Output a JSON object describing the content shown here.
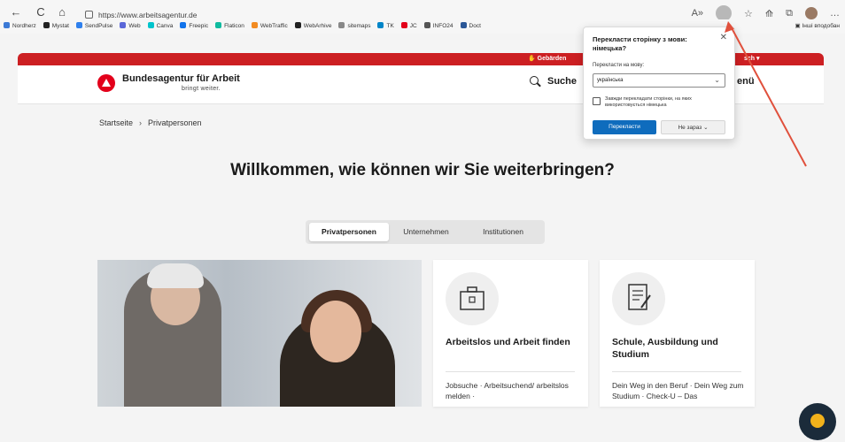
{
  "browser": {
    "url": "https://www.arbeitsagentur.de",
    "nav": {
      "back": "←",
      "reload": "C",
      "home": "⌂"
    },
    "toolbar_icons": [
      "A»",
      "☆",
      "⟰",
      "⧉",
      "…"
    ],
    "bookmarks": [
      {
        "label": "Nordherz",
        "color": "#3c7ad6"
      },
      {
        "label": "Mystat",
        "color": "#222222"
      },
      {
        "label": "SendPulse",
        "color": "#2f80ed"
      },
      {
        "label": "Web",
        "color": "#5a67d8"
      },
      {
        "label": "Canva",
        "color": "#00c4cc"
      },
      {
        "label": "Freepic",
        "color": "#1273eb"
      },
      {
        "label": "Flaticon",
        "color": "#10bb9f"
      },
      {
        "label": "WebTraffic",
        "color": "#f28b22"
      },
      {
        "label": "WebArhive",
        "color": "#222222"
      },
      {
        "label": "sitemaps",
        "color": "#888888"
      },
      {
        "label": "TK",
        "color": "#0085c8"
      },
      {
        "label": "JC",
        "color": "#e3001b"
      },
      {
        "label": "INFO24",
        "color": "#555555"
      },
      {
        "label": "Doct",
        "color": "#2b5797"
      }
    ],
    "bookmarks_more": "Інші вподобан"
  },
  "site": {
    "top_bar": {
      "gebarden": "Gebärden",
      "language": "sch"
    },
    "logo_title": "Bundesagentur für Arbeit",
    "logo_subtitle": "bringt weiter.",
    "search_label": "Suche",
    "menu_label": "enü",
    "breadcrumb": [
      "Startseite",
      "Privatpersonen"
    ],
    "headline": "Willkommen, wie können wir Sie weiterbringen?",
    "tabs": [
      "Privatpersonen",
      "Unternehmen",
      "Institutionen"
    ],
    "cards": [
      {
        "title": "Arbeitslos und Arbeit finden",
        "links": "Jobsuche · Arbeitsuchend/ arbeitslos melden ·"
      },
      {
        "title": "Schule, Ausbildung und Studium",
        "links": "Dein Weg in den Beruf · Dein Weg zum Studium · Check-U – Das"
      }
    ]
  },
  "translate_popup": {
    "title": "Перекласти сторінку з мови: німецька?",
    "label": "Перекласти на мову:",
    "selected_language": "українська",
    "checkbox_label": "Завжди перекладати сторінки, на яких використовується німецька",
    "translate_button": "Перекласти",
    "not_now_button": "Не зараз"
  },
  "annotation": {
    "arrow_color": "#e0503c"
  }
}
